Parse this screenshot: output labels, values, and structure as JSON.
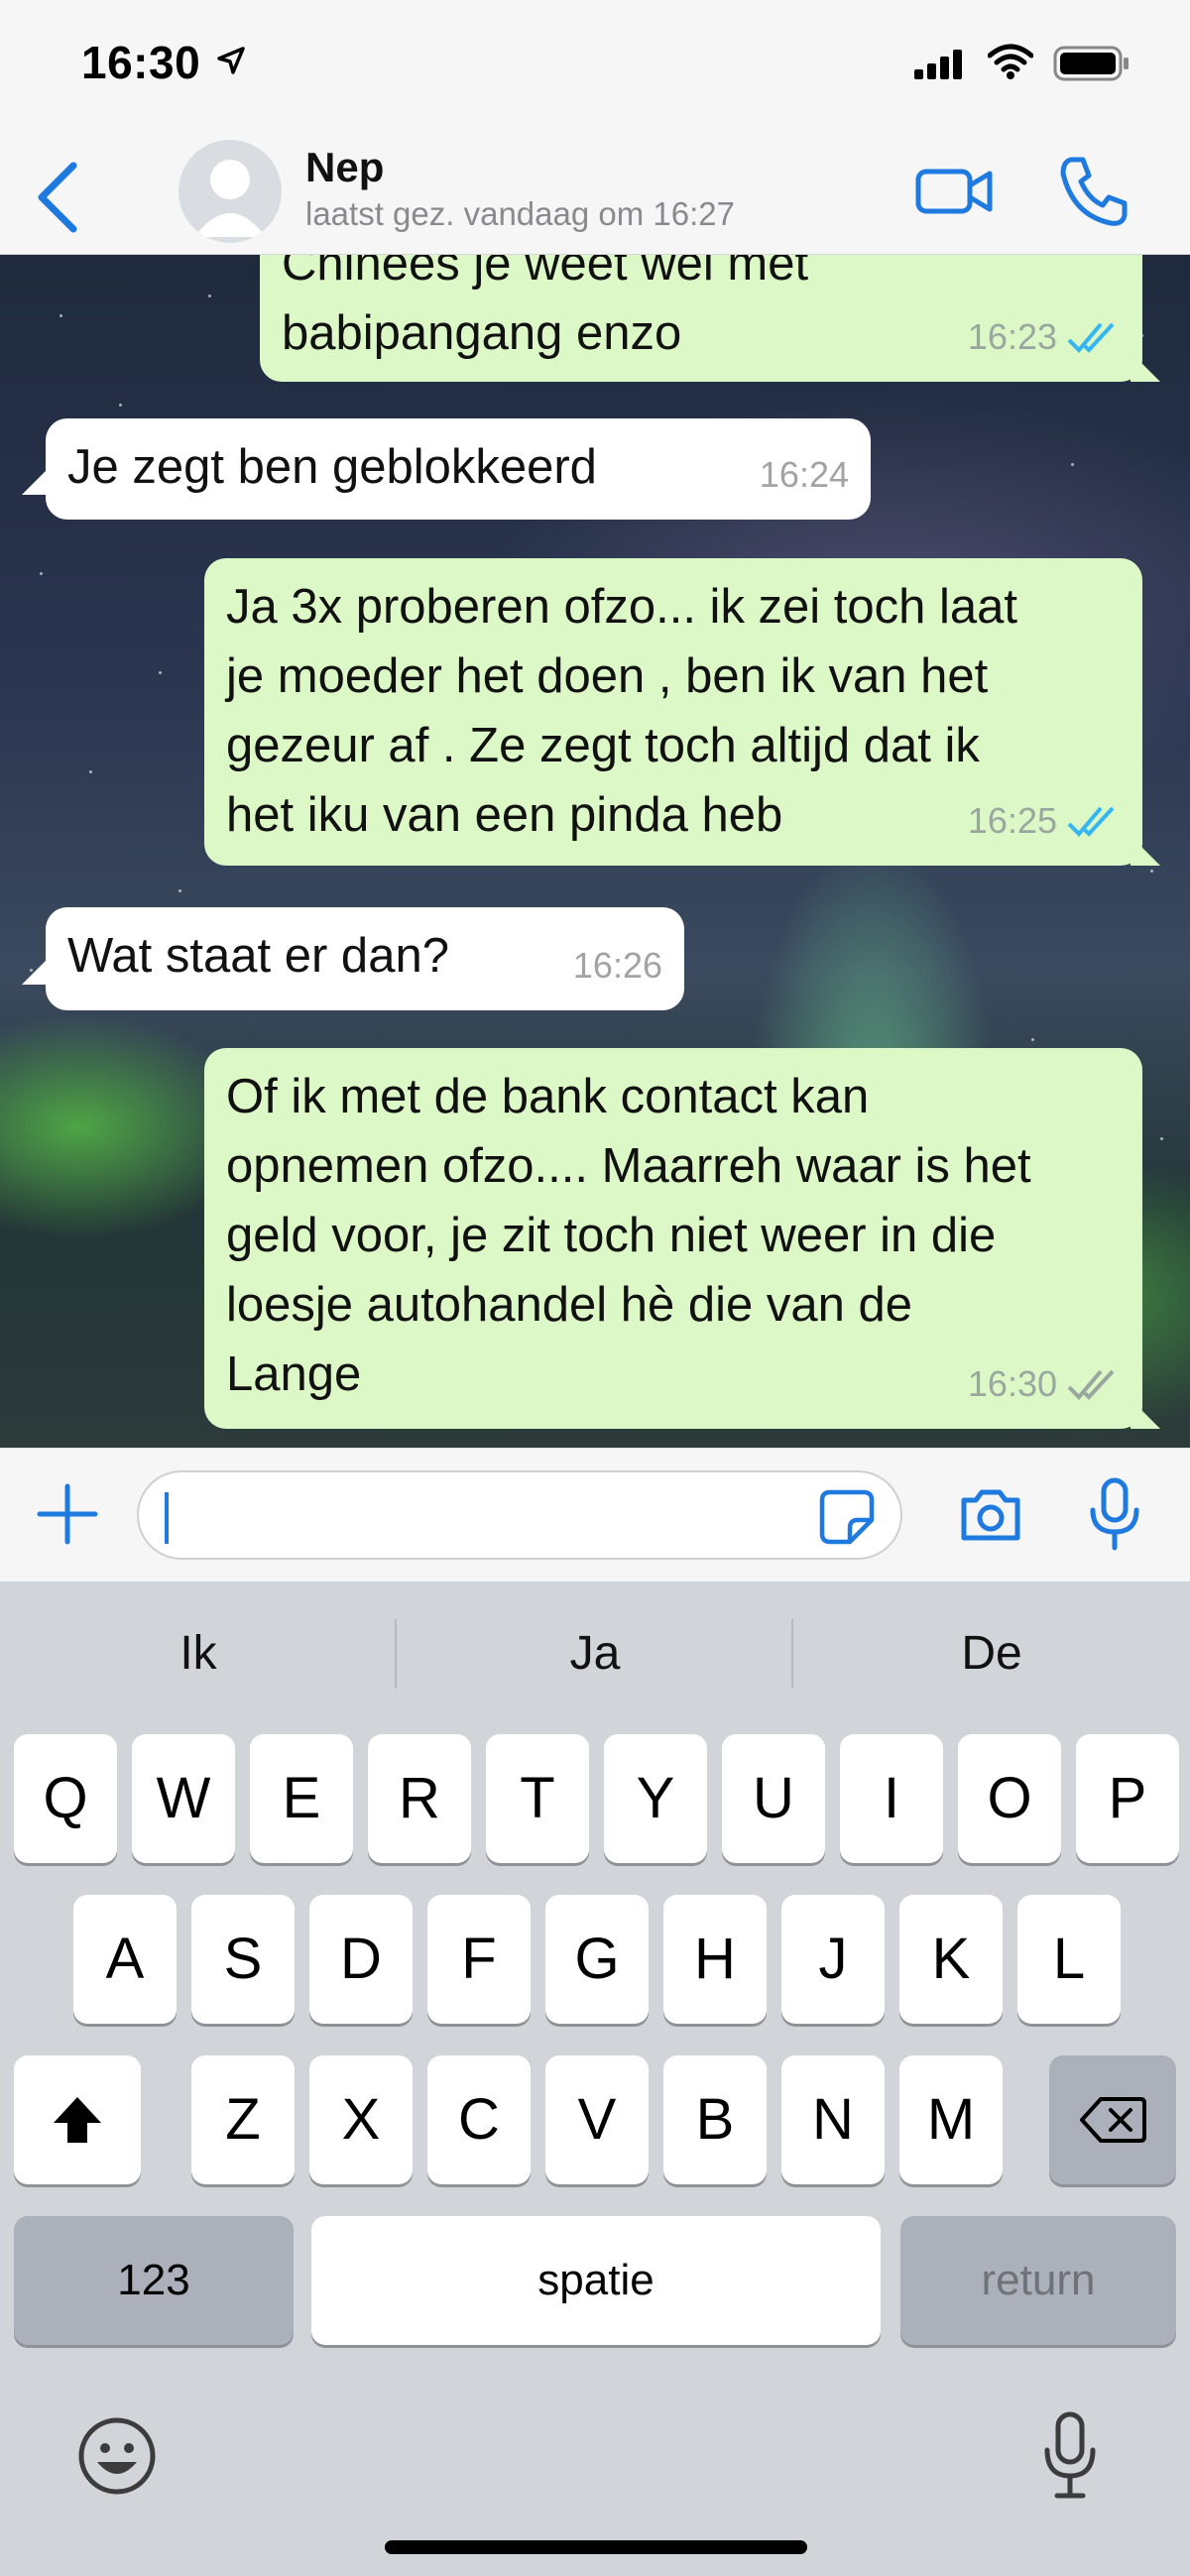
{
  "status_bar": {
    "time": "16:30",
    "icons": [
      "location-arrow-icon",
      "signal-icon",
      "wifi-icon",
      "battery-icon"
    ]
  },
  "header": {
    "contact_name": "Nep",
    "contact_status": "laatst gez. vandaag om 16:27",
    "icons": [
      "back-chevron-icon",
      "avatar-placeholder-icon",
      "video-call-icon",
      "phone-icon"
    ]
  },
  "messages": [
    {
      "direction": "out",
      "text": "Chinees je weet wel met\nbabipangang enzo",
      "time": "16:23",
      "status": "read"
    },
    {
      "direction": "in",
      "text": "Je zegt ben geblokkeerd",
      "time": "16:24"
    },
    {
      "direction": "out",
      "text": "Ja 3x proberen ofzo... ik zei toch laat\nje moeder het doen , ben ik van het\ngezeur af . Ze zegt toch altijd dat ik\nhet iku van een pinda heb",
      "time": "16:25",
      "status": "read"
    },
    {
      "direction": "in",
      "text": "Wat staat er dan?",
      "time": "16:26"
    },
    {
      "direction": "out",
      "text": "Of ik met de bank contact kan\nopnemen ofzo.... Maarreh waar is het\ngeld voor, je zit toch niet weer in die\nloesje autohandel hè die van de\nLange",
      "time": "16:30",
      "status": "delivered"
    }
  ],
  "input": {
    "value": "",
    "icons": [
      "plus-icon",
      "sticker-icon",
      "camera-icon",
      "microphone-icon"
    ]
  },
  "keyboard": {
    "suggestions": [
      "Ik",
      "Ja",
      "De"
    ],
    "row1": [
      "Q",
      "W",
      "E",
      "R",
      "T",
      "Y",
      "U",
      "I",
      "O",
      "P"
    ],
    "row2": [
      "A",
      "S",
      "D",
      "F",
      "G",
      "H",
      "J",
      "K",
      "L"
    ],
    "row3": [
      "Z",
      "X",
      "C",
      "V",
      "B",
      "N",
      "M"
    ],
    "numbers_key": "123",
    "space_key": "spatie",
    "return_key": "return",
    "icons": [
      "shift-icon",
      "backspace-icon",
      "emoji-icon",
      "dictation-icon"
    ]
  },
  "colors": {
    "accent": "#1f7ae0",
    "outgoing_bubble": "#dcf8c6",
    "incoming_bubble": "#ffffff",
    "read_ticks": "#34b7f1",
    "delivered_ticks": "#9aa7a0"
  }
}
